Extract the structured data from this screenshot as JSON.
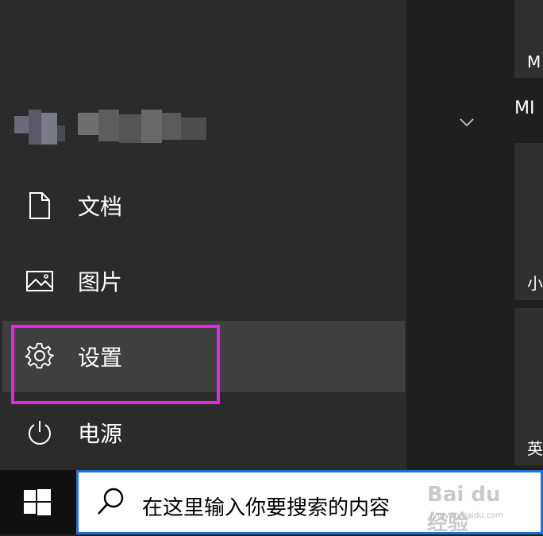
{
  "start_menu": {
    "user_name": "",
    "items": [
      {
        "label": "文档",
        "icon": "document-icon"
      },
      {
        "label": "图片",
        "icon": "pictures-icon"
      },
      {
        "label": "设置",
        "icon": "gear-icon"
      },
      {
        "label": "电源",
        "icon": "power-icon"
      }
    ]
  },
  "tiles": {
    "group_label": "MI",
    "tile_labels": [
      "M",
      "小",
      "英"
    ]
  },
  "taskbar": {
    "search_placeholder": "在这里输入你要搜索的内容"
  },
  "watermark": {
    "brand": "Bai du 经验",
    "sub": "jingyan.baidu.com"
  },
  "colors": {
    "menu_bg": "#2b2b2b",
    "highlight_bg": "#3f3f3f",
    "annotation_box": "#e626e6",
    "search_border": "#1e6fd9"
  }
}
